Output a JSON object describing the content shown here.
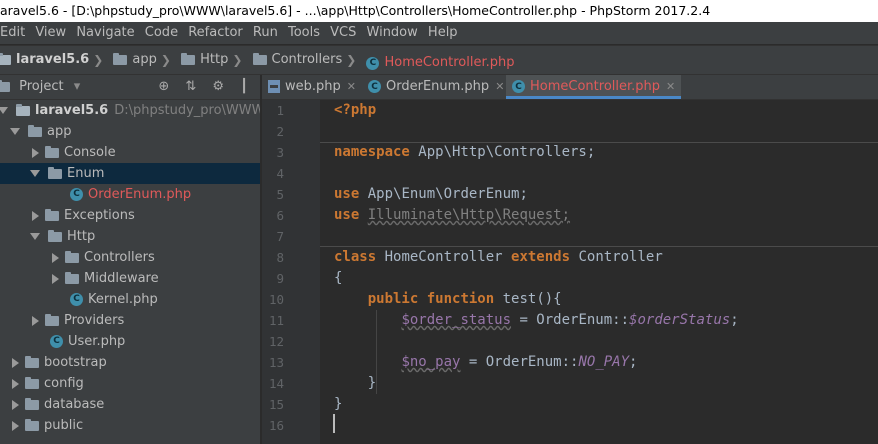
{
  "window": {
    "title": "aravel5.6 - [D:\\phpstudy_pro\\WWW\\laravel5.6] - ...\\app\\Http\\Controllers\\HomeController.php - PhpStorm 2017.2.4"
  },
  "menu": [
    "Edit",
    "View",
    "Navigate",
    "Code",
    "Refactor",
    "Run",
    "Tools",
    "VCS",
    "Window",
    "Help"
  ],
  "breadcrumbs": [
    {
      "label": "laravel5.6",
      "icon": "project-folder-icon"
    },
    {
      "label": "app",
      "icon": "folder-icon"
    },
    {
      "label": "Http",
      "icon": "folder-icon"
    },
    {
      "label": "Controllers",
      "icon": "folder-icon"
    },
    {
      "label": "HomeController.php",
      "icon": "class-icon"
    }
  ],
  "project_panel": {
    "title": "Project",
    "tools": "⊕ ⇅ ⚙ ┃"
  },
  "tree": [
    {
      "label": "laravel5.6",
      "hint": "D:\\phpstudy_pro\\WWW\\larav",
      "icon": "project-folder-icon",
      "arrow": "down",
      "depth": 0
    },
    {
      "label": "app",
      "icon": "folder-icon",
      "arrow": "down",
      "depth": 1
    },
    {
      "label": "Console",
      "icon": "folder-icon",
      "arrow": "right",
      "depth": 2
    },
    {
      "label": "Enum",
      "icon": "folder-icon",
      "arrow": "down",
      "depth": 2,
      "selected": true
    },
    {
      "label": "OrderEnum.php",
      "icon": "class-icon",
      "arrow": "none",
      "depth": 3,
      "red": true
    },
    {
      "label": "Exceptions",
      "icon": "folder-icon",
      "arrow": "right",
      "depth": 2
    },
    {
      "label": "Http",
      "icon": "folder-icon",
      "arrow": "down",
      "depth": 2
    },
    {
      "label": "Controllers",
      "icon": "folder-icon",
      "arrow": "right",
      "depth": 3
    },
    {
      "label": "Middleware",
      "icon": "folder-icon",
      "arrow": "right",
      "depth": 3
    },
    {
      "label": "Kernel.php",
      "icon": "class-icon",
      "arrow": "none",
      "depth": 3
    },
    {
      "label": "Providers",
      "icon": "folder-icon",
      "arrow": "right",
      "depth": 2
    },
    {
      "label": "User.php",
      "icon": "class-icon",
      "arrow": "none",
      "depth": 2
    },
    {
      "label": "bootstrap",
      "icon": "folder-icon",
      "arrow": "right",
      "depth": 1
    },
    {
      "label": "config",
      "icon": "folder-icon",
      "arrow": "right",
      "depth": 1
    },
    {
      "label": "database",
      "icon": "folder-icon",
      "arrow": "right",
      "depth": 1
    },
    {
      "label": "public",
      "icon": "folder-icon",
      "arrow": "right",
      "depth": 1
    }
  ],
  "tabs": [
    {
      "label": "web.php",
      "icon": "php-file-icon",
      "active": false
    },
    {
      "label": "OrderEnum.php",
      "icon": "class-icon",
      "active": false
    },
    {
      "label": "HomeController.php",
      "icon": "class-icon",
      "active": true
    }
  ],
  "editor": {
    "line_numbers": [
      "1",
      "2",
      "3",
      "4",
      "5",
      "6",
      "7",
      "8",
      "9",
      "10",
      "11",
      "12",
      "13",
      "14",
      "15",
      "16"
    ],
    "code": {
      "l1": "<?php",
      "l3_kw": "namespace",
      "l3_rest": " App\\Http\\Controllers;",
      "l5_kw": "use",
      "l5_rest": " App\\Enum\\OrderEnum;",
      "l6_kw": "use",
      "l6_rest": "Illuminate\\Http\\Request;",
      "l8_kw": "class",
      "l8_name": " HomeController ",
      "l8_kw2": "extends",
      "l8_parent": " Controller",
      "l9": "{",
      "l10_kw1": "public",
      "l10_kw2": "function",
      "l10_rest": " test(){",
      "l11_var": "$order_status",
      "l11_mid": " = OrderEnum::",
      "l11_static": "$orderStatus",
      "l11_end": ";",
      "l13_var": "$no_pay",
      "l13_mid": " = OrderEnum::",
      "l13_const": "NO_PAY",
      "l13_end": ";",
      "l14": "}",
      "l15": "}"
    }
  },
  "colors": {
    "keyword": "#cc7832",
    "text": "#a9b7c6",
    "field": "#9876aa",
    "selected_row": "#0d293e",
    "active_tab_text": "#e05a5a"
  }
}
